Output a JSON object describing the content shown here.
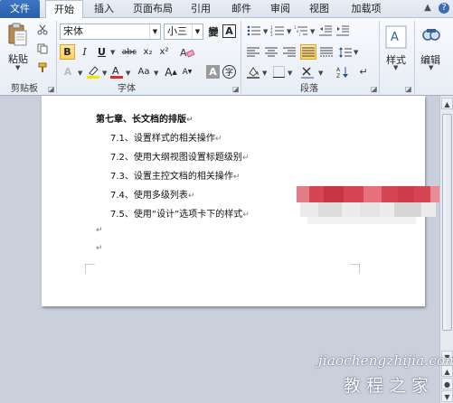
{
  "tabs": [
    {
      "label": "文件"
    },
    {
      "label": "开始"
    },
    {
      "label": "插入"
    },
    {
      "label": "页面布局"
    },
    {
      "label": "引用"
    },
    {
      "label": "邮件"
    },
    {
      "label": "审阅"
    },
    {
      "label": "视图"
    },
    {
      "label": "加载项"
    }
  ],
  "ribbon": {
    "clipboard": {
      "label": "剪贴板",
      "paste": "粘贴"
    },
    "font": {
      "label": "字体",
      "font_name": "宋体",
      "font_size": "小三",
      "bold": "B",
      "italic": "I",
      "underline": "U",
      "strike": "abc",
      "subscript": "x₂",
      "superscript": "x²",
      "grow": "A",
      "shrink": "A",
      "case": "Aa",
      "char_border": "A",
      "enclose": "字",
      "phonetic": "變",
      "highlight_color": "#f5e400",
      "font_color": "#d92b2b"
    },
    "paragraph": {
      "label": "段落"
    },
    "styles": {
      "label": "样式"
    },
    "editing": {
      "label": "编辑"
    }
  },
  "document": {
    "title": "第七章、长文档的排版",
    "items": [
      "7.1、设置样式的相关操作",
      "7.2、使用大纲视图设置标题级别",
      "7.3、设置主控文档的相关操作",
      "7.4、使用多级列表",
      "7.5、使用“设计”选项卡下的样式"
    ],
    "paragraph_mark": "↵",
    "line_break_mark": "↵"
  },
  "watermark": {
    "line1": "jiaochengzhijia.com",
    "line2": "教程之家"
  },
  "colors": {
    "file_tab": "#2a5ea8",
    "redaction_red": "#d64552"
  }
}
